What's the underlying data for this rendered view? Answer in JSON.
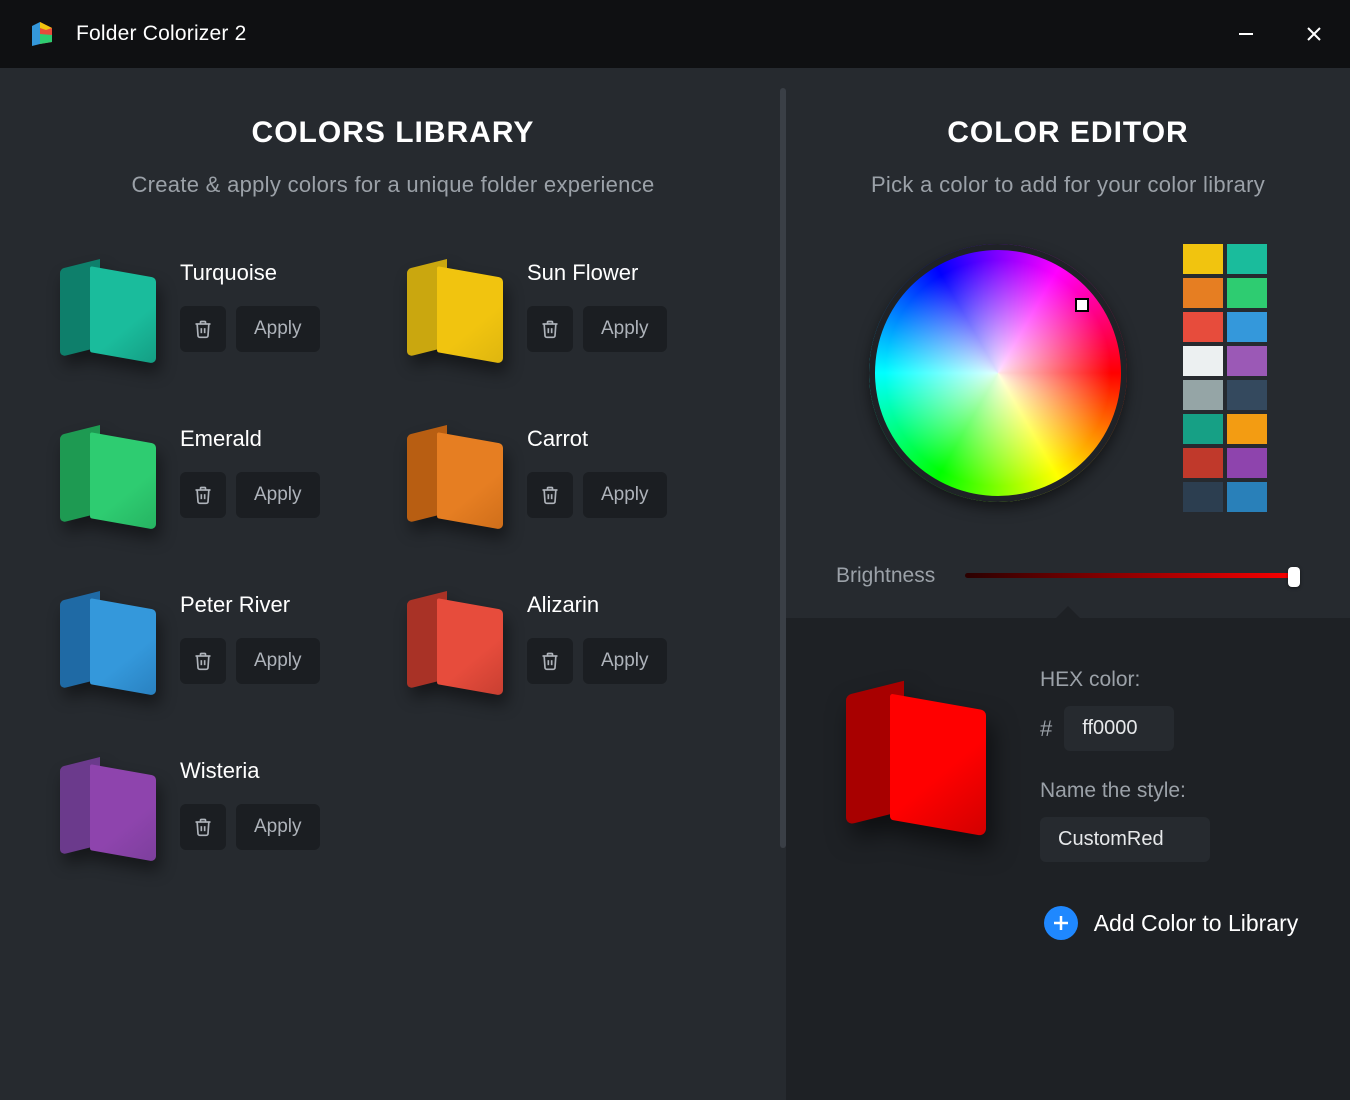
{
  "window": {
    "title": "Folder Colorizer 2"
  },
  "library": {
    "heading": "COLORS LIBRARY",
    "subheading": "Create & apply colors for a unique folder experience",
    "apply_label": "Apply",
    "items": [
      {
        "name": "Turquoise",
        "back": "#0e7f6b",
        "front": "#1abc9c"
      },
      {
        "name": "Sun Flower",
        "back": "#caa70f",
        "front": "#f1c40f"
      },
      {
        "name": "Emerald",
        "back": "#1e9a52",
        "front": "#2ecc71"
      },
      {
        "name": "Carrot",
        "back": "#b85e12",
        "front": "#e67e22"
      },
      {
        "name": "Peter River",
        "back": "#1f6aa5",
        "front": "#3498db"
      },
      {
        "name": "Alizarin",
        "back": "#a93226",
        "front": "#e74c3c"
      },
      {
        "name": "Wisteria",
        "back": "#6b3a8c",
        "front": "#8e44ad"
      }
    ]
  },
  "editor": {
    "heading": "COLOR EDITOR",
    "subheading": "Pick a color to add for your color library",
    "brightness_label": "Brightness",
    "swatches": [
      "#f1c40f",
      "#1abc9c",
      "#e67e22",
      "#2ecc71",
      "#e74c3c",
      "#3498db",
      "#ecf0f1",
      "#9b59b6",
      "#95a5a6",
      "#34495e",
      "#16a085",
      "#f39c12",
      "#c0392b",
      "#8e44ad",
      "#2c3e50",
      "#2980b9"
    ],
    "hex_label": "HEX color:",
    "hex_prefix": "#",
    "hex_value": "ff0000",
    "name_label": "Name the style:",
    "name_value": "CustomRed",
    "preview": {
      "back": "#a80000",
      "front": "#ff0000"
    },
    "add_label": "Add Color to Library"
  }
}
